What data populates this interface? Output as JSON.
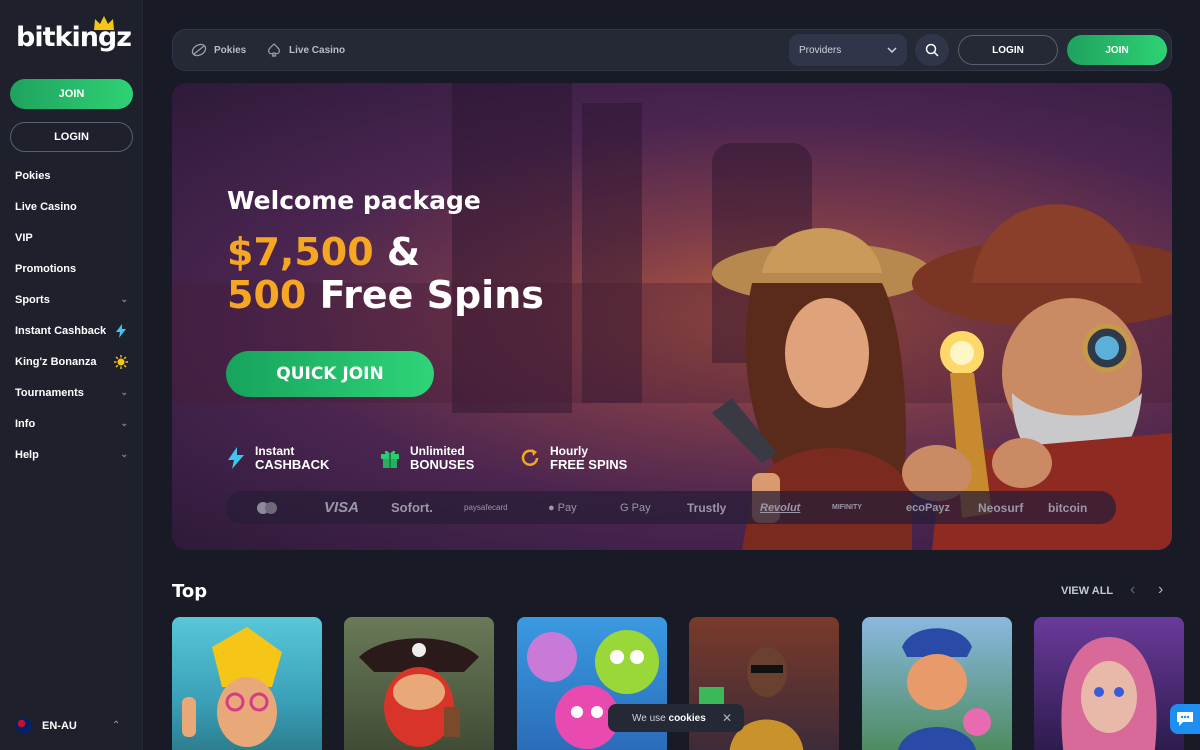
{
  "brand": {
    "name": "bitkingz"
  },
  "sidebar": {
    "join_label": "JOIN",
    "login_label": "LOGIN",
    "items": [
      {
        "label": "Pokies"
      },
      {
        "label": "Live Casino"
      },
      {
        "label": "VIP"
      },
      {
        "label": "Promotions"
      },
      {
        "label": "Sports",
        "chevron": "chevron-down-icon"
      },
      {
        "label": "Instant Cashback",
        "icon": "lightning-icon"
      },
      {
        "label": "King'z Bonanza",
        "icon": "sun-icon"
      },
      {
        "label": "Tournaments",
        "chevron": "chevron-down-icon"
      },
      {
        "label": "Info",
        "chevron": "chevron-down-icon"
      },
      {
        "label": "Help",
        "chevron": "chevron-down-icon"
      }
    ],
    "language": "EN-AU"
  },
  "topbar": {
    "pokies_label": "Pokies",
    "live_casino_label": "Live Casino",
    "providers_label": "Providers",
    "login_label": "LOGIN",
    "join_label": "JOIN"
  },
  "hero": {
    "title": "Welcome package",
    "amount": "$7,500",
    "amp": "&",
    "spins_count": "500",
    "spins_text": "Free Spins",
    "cta_label": "QUICK JOIN",
    "features": [
      {
        "small": "Instant",
        "big": "CASHBACK"
      },
      {
        "small": "Unlimited",
        "big": "BONUSES"
      },
      {
        "small": "Hourly",
        "big": "FREE SPINS"
      }
    ],
    "payments": [
      "VISA",
      "Sofort.",
      "paysafecard",
      "Pay",
      "G Pay",
      "Trustly",
      "Revolut",
      "MIFINITY",
      "ecoPayz",
      "Neosurf",
      "bitcoin"
    ]
  },
  "top_section": {
    "title": "Top",
    "view_all_label": "VIEW ALL"
  },
  "cookie": {
    "prefix": "We use",
    "bold": "cookies"
  },
  "colors": {
    "accent_green": "#2ed274",
    "gold": "#f5a623",
    "background": "#181b25"
  }
}
